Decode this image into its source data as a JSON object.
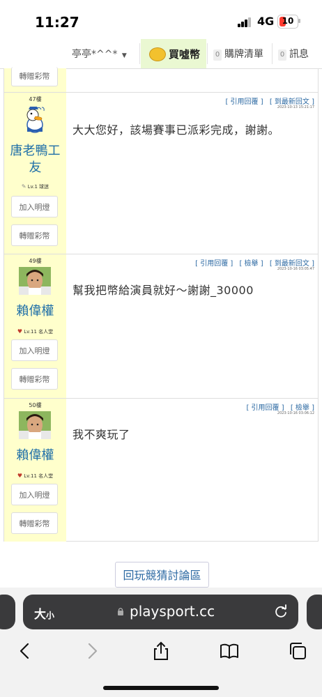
{
  "status_bar": {
    "time": "11:27",
    "network": "4G",
    "battery": "10"
  },
  "top_nav": {
    "user": "亭亭*^^*",
    "buy_coins": "買噓幣",
    "cart_count": "0",
    "cart_label": "購牌清單",
    "msg_count": "0",
    "msg_label": "訊息"
  },
  "first_post": {
    "gift_button": "轉贈彩幣"
  },
  "posts": [
    {
      "floor": "47樓",
      "user_name": "唐老鴨工友",
      "level": "Lv.1 球迷",
      "add_light": "加入明燈",
      "gift": "轉贈彩幣",
      "links": [
        "[ 引用回覆 ]",
        "[ 到最新回文 ]"
      ],
      "timestamp": "2023-10-13 15:21:17",
      "body": "大大您好，該場賽事已派彩完成，謝謝。"
    },
    {
      "floor": "49樓",
      "user_name": "賴偉權",
      "level": "Lv.11 名人堂",
      "add_light": "加入明燈",
      "gift": "轉贈彩幣",
      "links": [
        "[ 引用回覆 ]",
        "[ 檢舉 ]",
        "[ 到最新回文 ]"
      ],
      "timestamp": "2023-10-16 03:05:47",
      "body": "幫我把幣給演員就好～謝謝_30000"
    },
    {
      "floor": "50樓",
      "user_name": "賴偉權",
      "level": "Lv.11 名人堂",
      "add_light": "加入明燈",
      "gift": "轉贈彩幣",
      "links": [
        "[ 引用回覆 ]",
        "[ 檢舉 ]"
      ],
      "timestamp": "2023-10-16 03:06:12",
      "body": "我不爽玩了"
    }
  ],
  "back_button": "回玩競猜討論區",
  "browser": {
    "text_size": "大",
    "text_size_small": "小",
    "host": "playsport.cc"
  }
}
